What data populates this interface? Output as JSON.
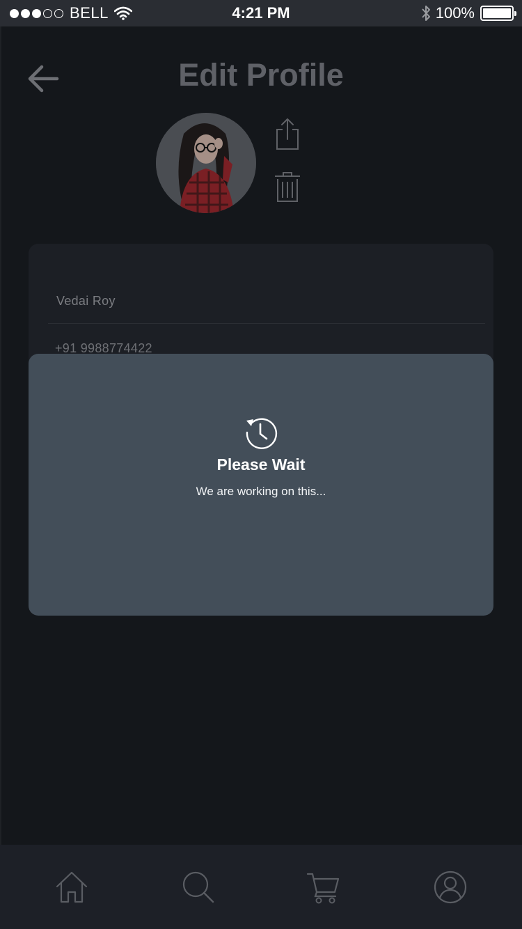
{
  "status_bar": {
    "carrier": "BELL",
    "time": "4:21 PM",
    "battery": "100%",
    "signal_bars": 3,
    "signal_total": 5
  },
  "header": {
    "title": "Edit Profile",
    "back_icon": "arrow-left-icon"
  },
  "profile": {
    "avatar_icon": "profile-photo",
    "upload_icon": "share-upload-icon",
    "delete_icon": "trash-icon"
  },
  "form": {
    "name_value": "Vedai Roy",
    "phone_value": "+91 9988774422"
  },
  "dialog": {
    "icon": "clock-history-icon",
    "title": "Please Wait",
    "message": "We are working on this..."
  },
  "bottom_nav": {
    "items": [
      {
        "icon": "home-icon"
      },
      {
        "icon": "search-icon"
      },
      {
        "icon": "cart-icon"
      },
      {
        "icon": "user-icon"
      }
    ]
  },
  "colors": {
    "background": "#14171b",
    "card": "#1c1f25",
    "dialog": "#434e59",
    "nav": "#1d2027",
    "muted_text": "#7a7c81"
  }
}
